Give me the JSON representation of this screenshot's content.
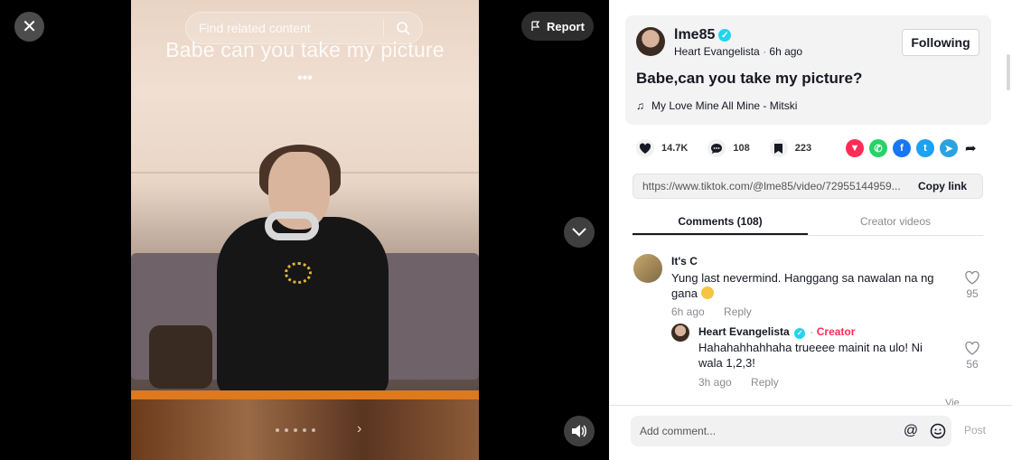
{
  "video": {
    "overlay_text": "Babe can you take my picture",
    "overlay_more": "•••",
    "search_placeholder": "Find related content",
    "report_label": "Report"
  },
  "post": {
    "username": "lme85",
    "display_name": "Heart Evangelista",
    "time_ago": "6h ago",
    "follow_label": "Following",
    "caption": "Babe,can you take my picture?",
    "music": "My Love Mine All Mine - Mitski"
  },
  "stats": {
    "likes": "14.7K",
    "comments": "108",
    "saves": "223"
  },
  "share_icons": [
    {
      "name": "repost-icon",
      "color": "#fe2c55",
      "glyph": "▼"
    },
    {
      "name": "whatsapp-icon",
      "color": "#25d366",
      "glyph": "✆"
    },
    {
      "name": "facebook-icon",
      "color": "#1877f2",
      "glyph": "f"
    },
    {
      "name": "twitter-icon",
      "color": "#1da1f2",
      "glyph": "t"
    },
    {
      "name": "telegram-icon",
      "color": "#2aa3df",
      "glyph": "➤"
    }
  ],
  "link": {
    "url": "https://www.tiktok.com/@lme85/video/72955144959...",
    "copy_label": "Copy link"
  },
  "tabs": {
    "comments": "Comments (108)",
    "creator_videos": "Creator videos"
  },
  "comments": [
    {
      "name": "It's C",
      "text": "Yung last nevermind. Hanggang sa nawalan na ng gana",
      "time": "6h ago",
      "reply_label": "Reply",
      "likes": "95"
    },
    {
      "name": "Heart Evangelista",
      "badge": "Creator",
      "text": "Hahahahhahhaha trueeee mainit na ulo! Ni wala 1,2,3!",
      "time": "3h ago",
      "reply_label": "Reply",
      "likes": "56"
    }
  ],
  "more_replies": "Vie",
  "composer": {
    "placeholder": "Add comment...",
    "mention_icon": "@",
    "post_label": "Post"
  },
  "colors": {
    "accent": "#fe2c55",
    "verified": "#20d5ec"
  }
}
